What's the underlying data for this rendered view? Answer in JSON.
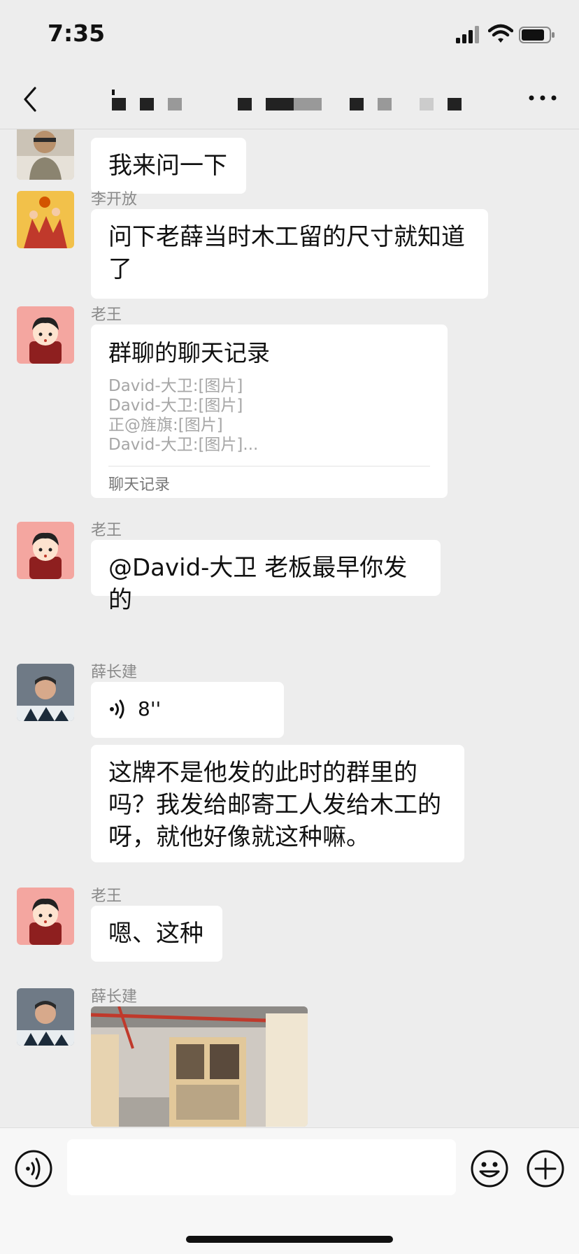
{
  "status": {
    "time": "7:35"
  },
  "header": {
    "title": "'"
  },
  "messages": [
    {
      "text": "我来问一下"
    },
    {
      "sender": "李开放",
      "text": "问下老薛当时木工留的尺寸就知道了"
    },
    {
      "sender": "老王",
      "record": {
        "title": "群聊的聊天记录",
        "lines": [
          "David-大卫:[图片]",
          "David-大卫:[图片]",
          "正@旌旗:[图片]",
          "David-大卫:[图片]..."
        ],
        "footer": "聊天记录"
      }
    },
    {
      "sender": "老王",
      "text": "@David-大卫 老板最早你发的"
    },
    {
      "sender": "薛长建",
      "voice_length": "8''",
      "text": "这牌不是他发的此时的群里的吗？我发给邮寄工人发给木工的呀，就他好像就这种嘛。"
    },
    {
      "sender": "老王",
      "text": "嗯、这种"
    },
    {
      "sender": "薛长建",
      "image": "photo"
    }
  ],
  "icons": {
    "back": "chevron-left-icon",
    "more": "more-dots-icon",
    "voice": "voice-icon",
    "emoji": "emoji-icon",
    "plus": "plus-icon"
  },
  "colors": {
    "background": "#ededed",
    "bubble": "#ffffff",
    "sender": "#8a8a8a"
  }
}
